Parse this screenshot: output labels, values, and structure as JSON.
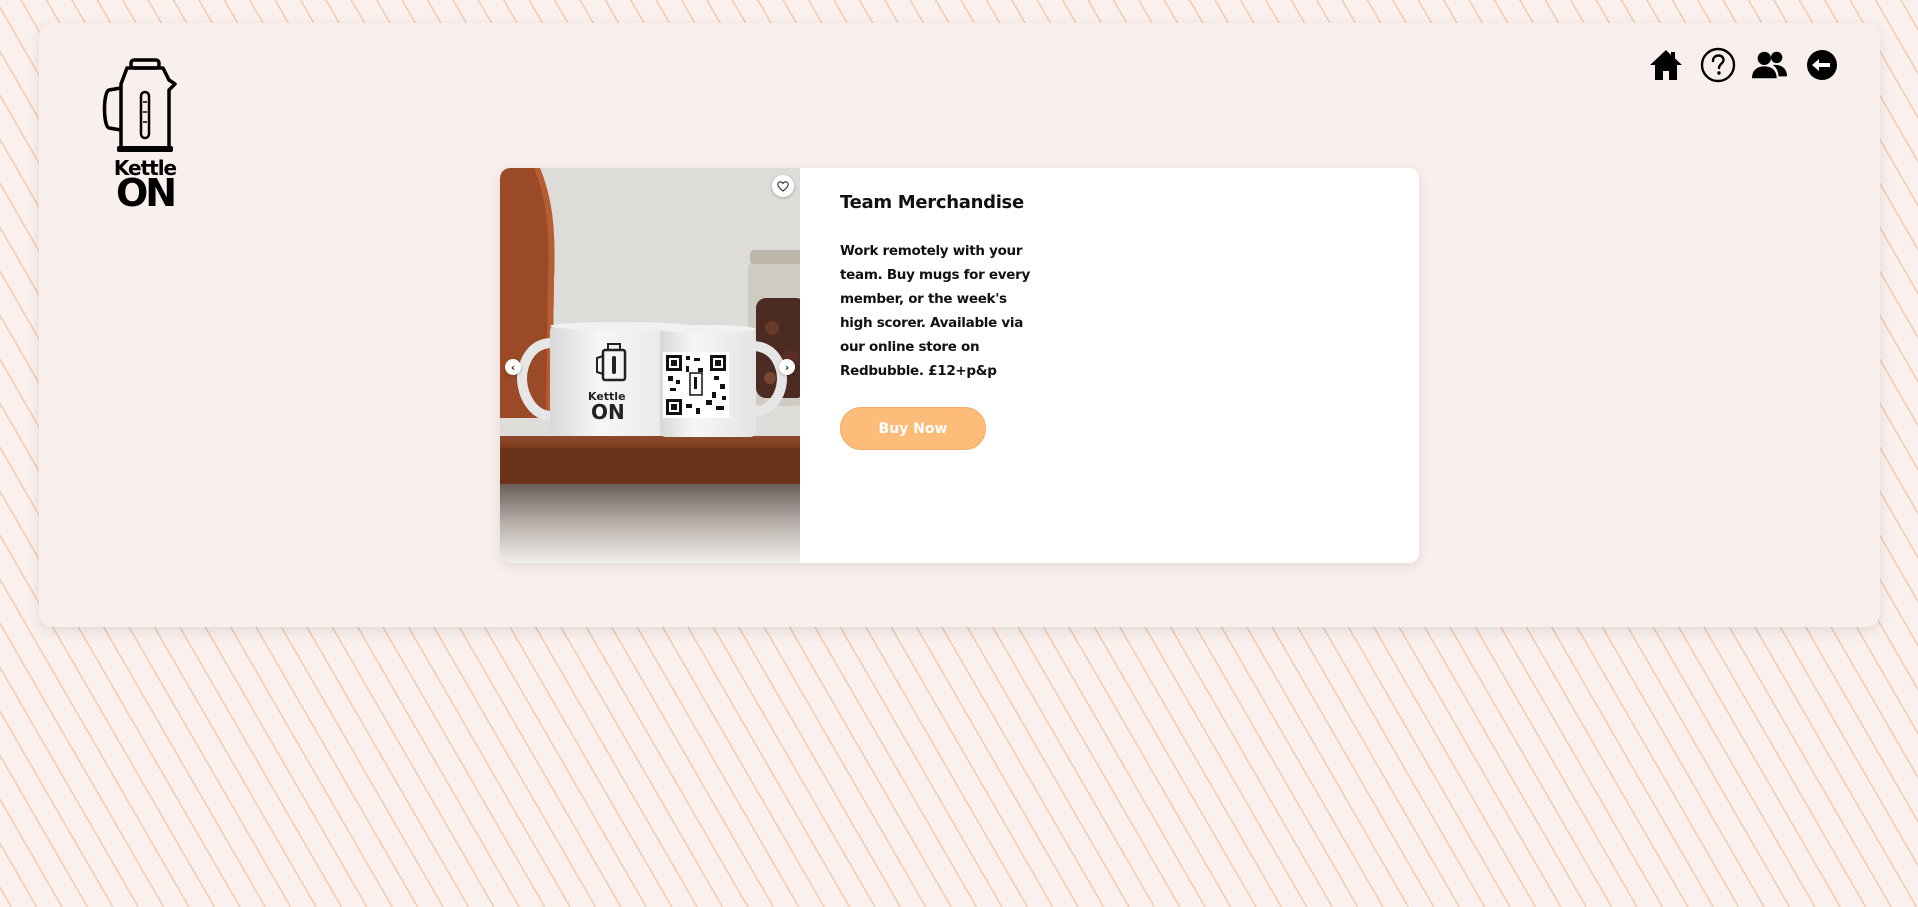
{
  "brand": {
    "logo_line1": "Kettle",
    "logo_line2": "ON",
    "logo_icon": "kettle-icon"
  },
  "nav": {
    "items": [
      {
        "icon": "home-icon"
      },
      {
        "icon": "help-icon"
      },
      {
        "icon": "team-icon"
      },
      {
        "icon": "logout-icon"
      }
    ]
  },
  "product": {
    "title": "Team Merchandise",
    "description": "Work remotely with your team. Buy mugs for every member, or the week's high scorer. Available via our online store on Redbubble. £12+p&p",
    "buy_label": "Buy Now",
    "image_icons": {
      "favorite": "heart-icon",
      "prev": "chevron-left-icon",
      "next": "chevron-right-icon"
    },
    "mug_print": {
      "line1": "Kettle",
      "line2": "ON"
    }
  },
  "colors": {
    "page_background": "#faf1ee",
    "pattern_accent": "#f0aa78",
    "panel": "#f9efec",
    "card": "#ffffff",
    "buy_button": "#fdbc79",
    "text": "#111111"
  }
}
